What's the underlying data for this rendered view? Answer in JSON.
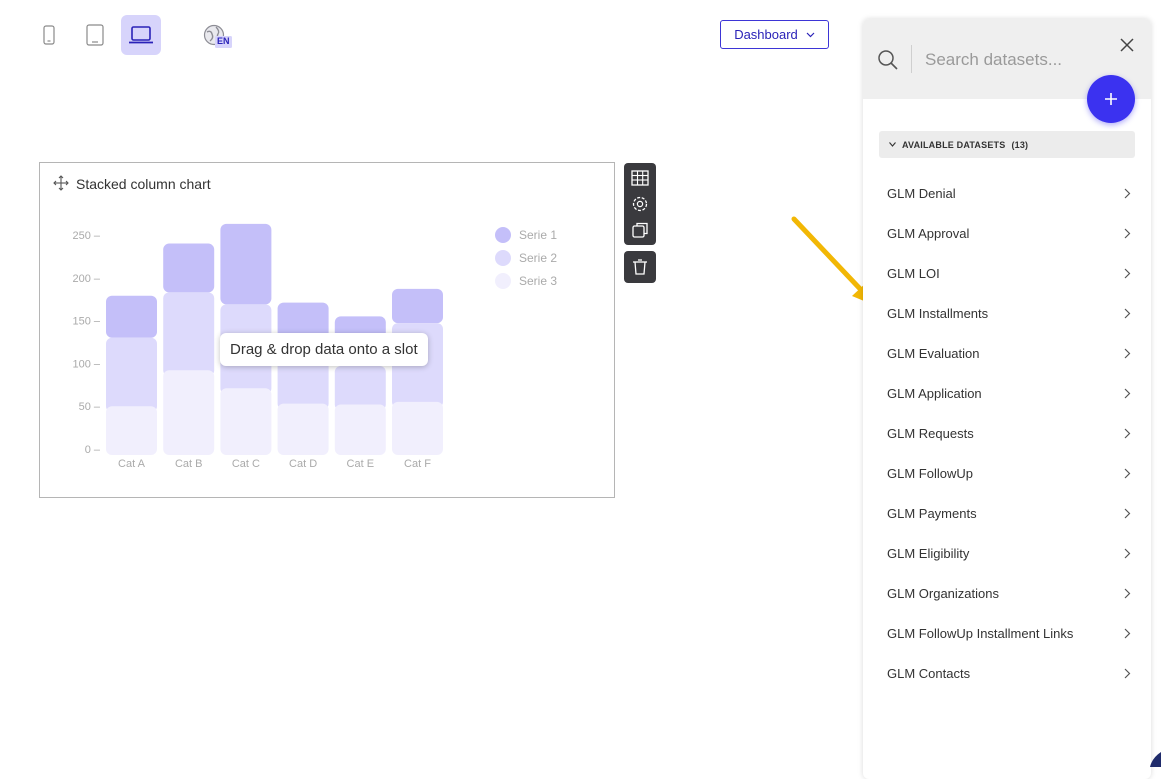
{
  "toolbar": {
    "devices": [
      {
        "name": "mobile",
        "icon": "mobile-icon",
        "active": false
      },
      {
        "name": "tablet",
        "icon": "tablet-icon",
        "active": false
      },
      {
        "name": "laptop",
        "icon": "laptop-icon",
        "active": true
      }
    ],
    "language_badge": "EN",
    "dashboard_label": "Dashboard"
  },
  "chart_card": {
    "title": "Stacked column chart",
    "tooltip": "Drag & drop data onto a slot"
  },
  "chart_data": {
    "type": "bar",
    "stacked": true,
    "categories": [
      "Cat A",
      "Cat B",
      "Cat C",
      "Cat D",
      "Cat E",
      "Cat F"
    ],
    "series": [
      {
        "name": "Serie 3",
        "values": [
          50,
          92,
          71,
          53,
          52,
          55
        ],
        "color": "#f1effd"
      },
      {
        "name": "Serie 2",
        "values": [
          80,
          91,
          98,
          62,
          45,
          92
        ],
        "color": "#dddafc"
      },
      {
        "name": "Serie 1",
        "values": [
          49,
          57,
          94,
          56,
          58,
          40
        ],
        "color": "#c4bff9"
      }
    ],
    "ylim": [
      0,
      250
    ],
    "yticks": [
      "250 –",
      "200 –",
      "150 –",
      "100 –",
      "50 –",
      "0 –"
    ],
    "legend_position": "top-right",
    "grid": false
  },
  "panel": {
    "search_placeholder": "Search datasets...",
    "group_label": "AVAILABLE DATASETS",
    "group_count": "(13)",
    "datasets": [
      "GLM Denial",
      "GLM Approval",
      "GLM LOI",
      "GLM Installments",
      "GLM Evaluation",
      "GLM Application",
      "GLM Requests",
      "GLM FollowUp",
      "GLM Payments",
      "GLM Eligibility",
      "GLM Organizations",
      "GLM FollowUp Installment Links",
      "GLM Contacts"
    ]
  },
  "colors": {
    "accent": "#3b32f0",
    "arrow": "#f2b705"
  }
}
